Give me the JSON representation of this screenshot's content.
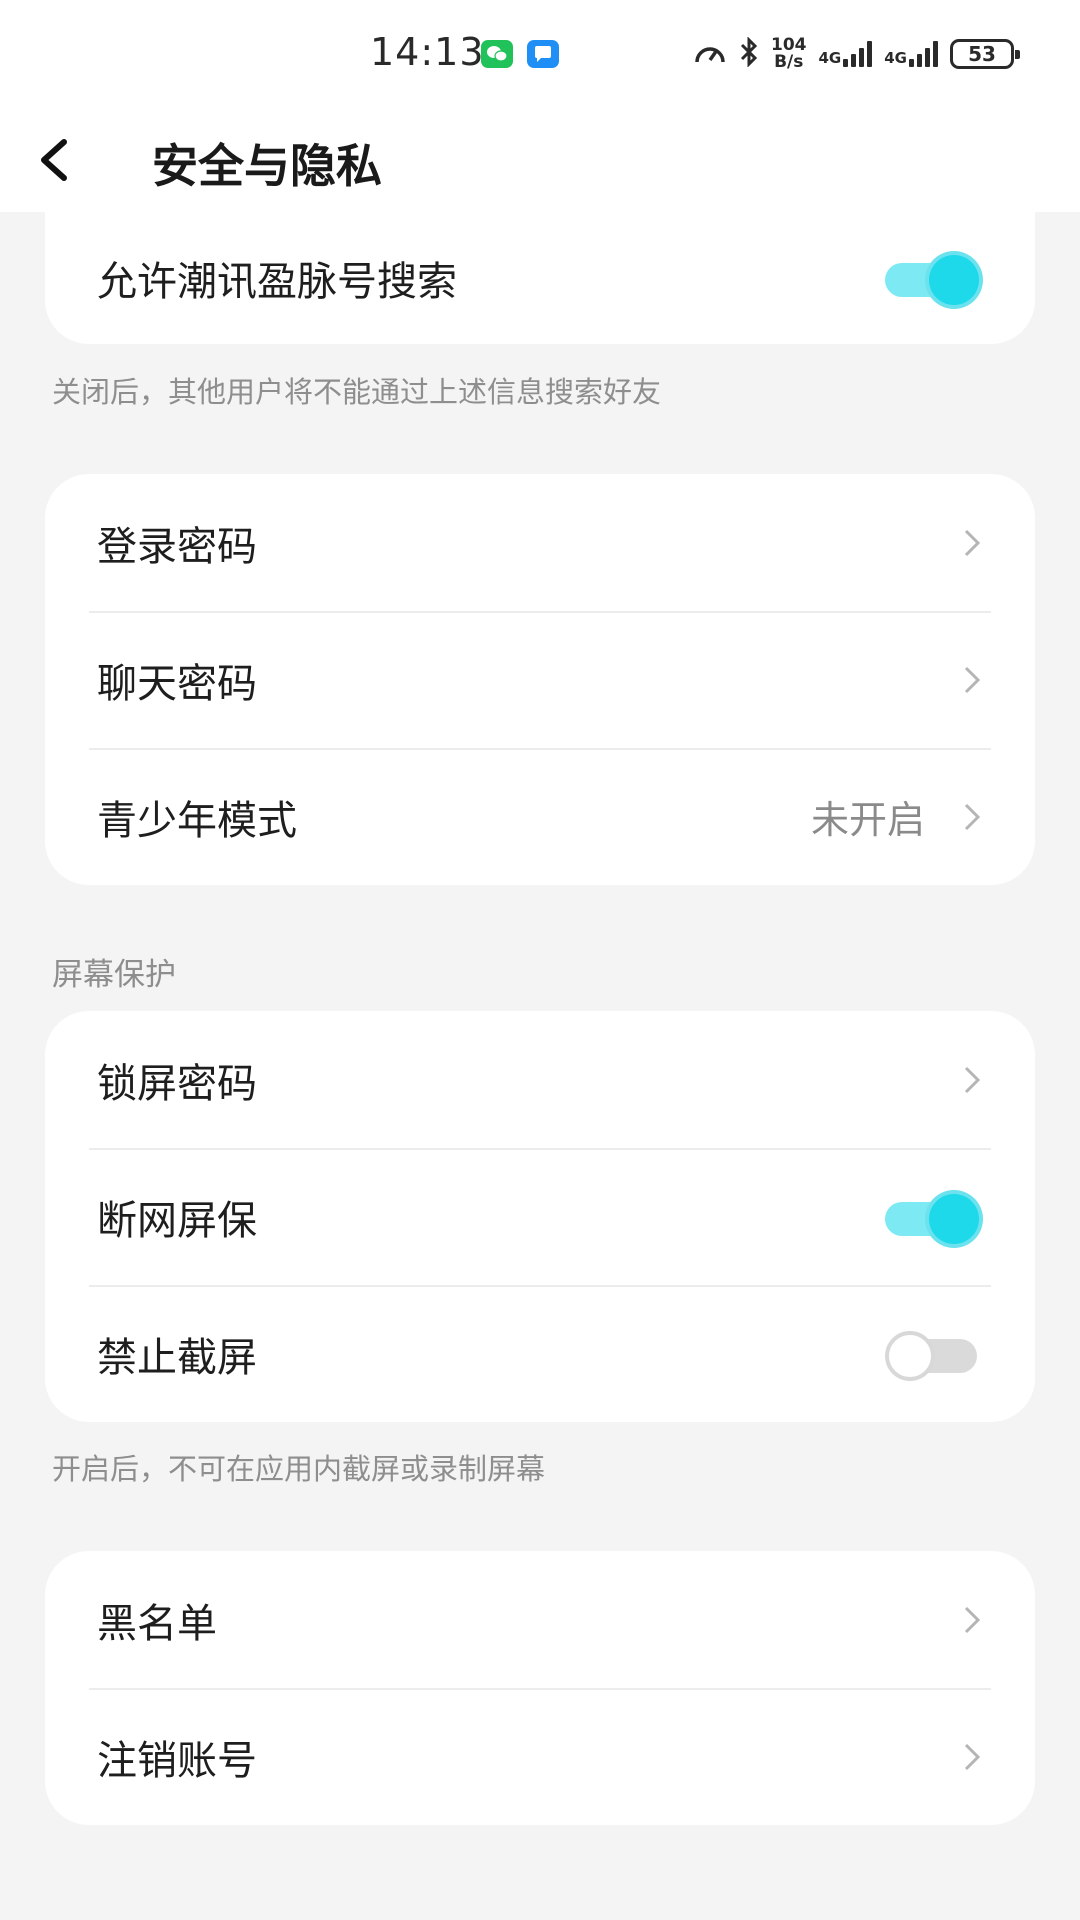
{
  "status_bar": {
    "time": "14:13",
    "apps": [
      "wechat-icon",
      "message-icon"
    ],
    "speed_value": "104",
    "speed_unit": "B/s",
    "net1": "4G",
    "net2": "4G",
    "battery": "53"
  },
  "header": {
    "title": "安全与隐私"
  },
  "search_card": {
    "label": "允许潮讯盈脉号搜索",
    "toggle_on": true
  },
  "search_note": "关闭后，其他用户将不能通过上述信息搜索好友",
  "password_card": {
    "items": [
      {
        "label": "登录密码",
        "value": ""
      },
      {
        "label": "聊天密码",
        "value": ""
      },
      {
        "label": "青少年模式",
        "value": "未开启"
      }
    ]
  },
  "screen_section": {
    "title": "屏幕保护",
    "items": [
      {
        "label": "锁屏密码"
      },
      {
        "label": "断网屏保",
        "toggle_on": true
      },
      {
        "label": "禁止截屏",
        "toggle_on": false
      }
    ],
    "note": "开启后，不可在应用内截屏或录制屏幕"
  },
  "account_card": {
    "items": [
      {
        "label": "黑名单"
      },
      {
        "label": "注销账号"
      }
    ]
  },
  "colors": {
    "accent": "#1dd9ea",
    "background": "#f4f4f5"
  }
}
